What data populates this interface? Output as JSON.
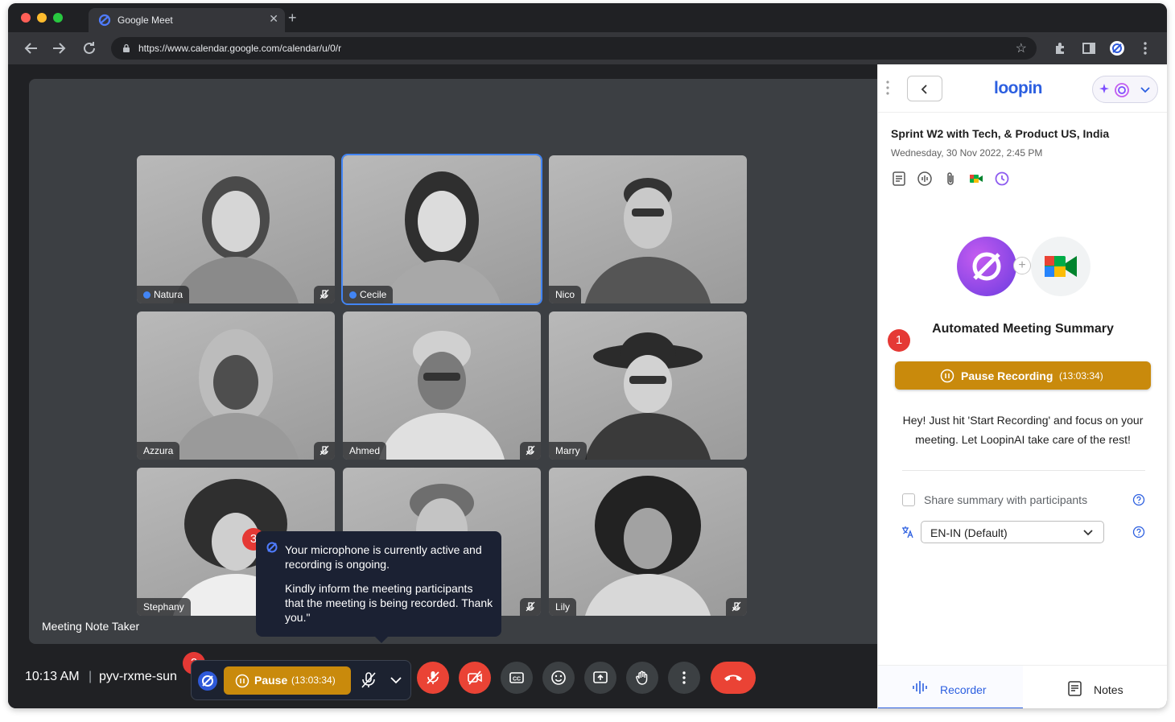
{
  "browser": {
    "tab_title": "Google Meet",
    "url": "https://www.calendar.google.com/calendar/u/0/r"
  },
  "meet": {
    "participants": [
      {
        "name": "Natura",
        "muted": true,
        "verified": true
      },
      {
        "name": "Cecile",
        "muted": false,
        "verified": true,
        "active_speaker": true
      },
      {
        "name": "Nico",
        "muted": false,
        "verified": false
      },
      {
        "name": "Azzura",
        "muted": true,
        "verified": false
      },
      {
        "name": "Ahmed",
        "muted": true,
        "verified": false
      },
      {
        "name": "Marry",
        "muted": false,
        "verified": false
      },
      {
        "name": "Stephany",
        "muted": false,
        "verified": false
      },
      {
        "name": "",
        "muted": true,
        "verified": false
      },
      {
        "name": "Lily",
        "muted": true,
        "verified": false
      }
    ],
    "stage_label": "Meeting Note Taker",
    "time": "10:13 AM",
    "separator": "|",
    "meeting_code": "pyv-rxme-sun",
    "pause_label": "Pause",
    "pause_timer": "(13:03:34)",
    "tooltip": {
      "line1": "Your microphone is currently active and recording is ongoing.",
      "line2": "Kindly inform the meeting participants that the meeting is being recorded. Thank you.\""
    },
    "steps": [
      "1",
      "2",
      "3"
    ]
  },
  "panel": {
    "brand": "loopin",
    "meeting_title": "Sprint W2 with Tech, & Product US, India",
    "meeting_date": "Wednesday, 30 Nov 2022, 2:45 PM",
    "plus": "+",
    "heading": "Automated Meeting Summary",
    "pause_recording_label": "Pause Recording",
    "pause_recording_timer": "(13:03:34)",
    "helper_text": "Hey! Just hit 'Start Recording' and focus on your meeting. Let LoopinAI take care of the rest!",
    "share_label": "Share summary with participants",
    "share_checked": false,
    "language_value": "EN-IN (Default)",
    "tabs": [
      {
        "label": "Recorder",
        "active": true
      },
      {
        "label": "Notes",
        "active": false
      }
    ]
  },
  "colors": {
    "accent": "#2c5fe0",
    "recording": "#c98a0c",
    "danger": "#ea4335",
    "step_badge": "#e53935"
  }
}
